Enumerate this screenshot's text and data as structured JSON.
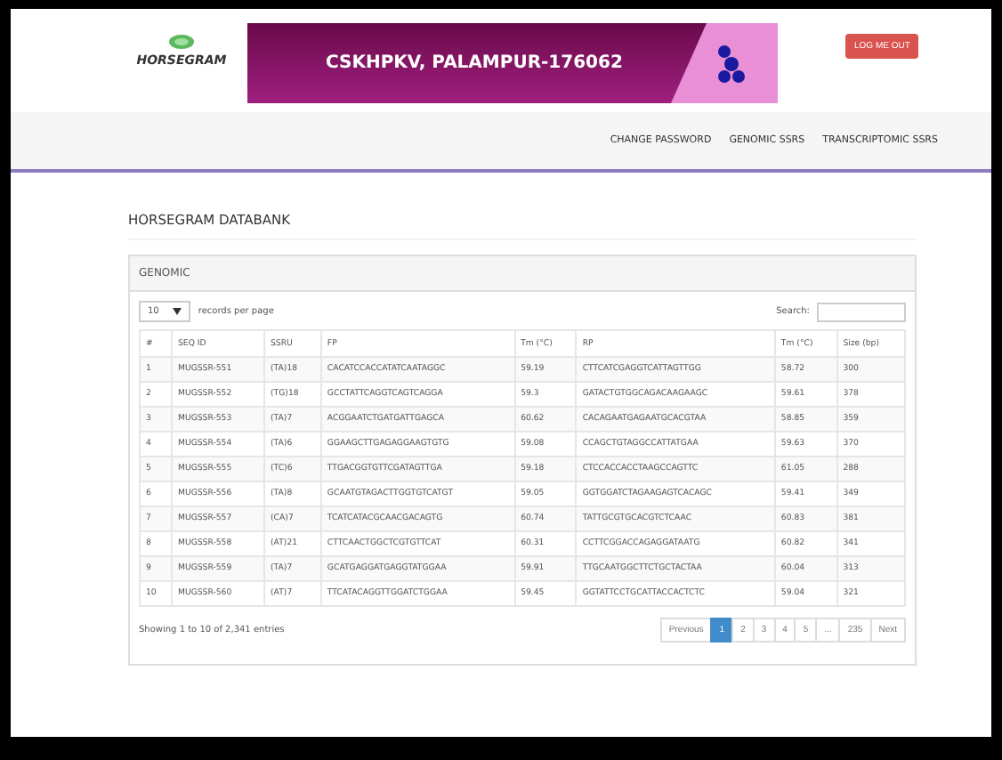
{
  "header": {
    "logo_text": "HORSEGRAM",
    "banner_title": "CSKHPKV, PALAMPUR-176062",
    "logout_button": "LOG ME OUT"
  },
  "nav": [
    {
      "label": "CHANGE PASSWORD"
    },
    {
      "label": "GENOMIC SSRS"
    },
    {
      "label": "TRANSCRIPTOMIC SSRS"
    }
  ],
  "page_title": "HORSEGRAM DATABANK",
  "panel": {
    "title": "GENOMIC",
    "page_size": "10",
    "page_size_label": "records per page",
    "search_label": "Search:",
    "columns": [
      "#",
      "SEQ ID",
      "SSRU",
      "FP",
      "Tm (°C)",
      "RP",
      "Tm (°C)",
      "Size (bp)"
    ],
    "rows": [
      [
        "1",
        "MUGSSR-551",
        "(TA)18",
        "CACATCCACCATATCAATAGGC",
        "59.19",
        "CTTCATCGAGGTCATTAGTTGG",
        "58.72",
        "300"
      ],
      [
        "2",
        "MUGSSR-552",
        "(TG)18",
        "GCCTATTCAGGTCAGTCAGGA",
        "59.3",
        "GATACTGTGGCAGACAAGAAGC",
        "59.61",
        "378"
      ],
      [
        "3",
        "MUGSSR-553",
        "(TA)7",
        "ACGGAATCTGATGATTGAGCA",
        "60.62",
        "CACAGAATGAGAATGCACGTAA",
        "58.85",
        "359"
      ],
      [
        "4",
        "MUGSSR-554",
        "(TA)6",
        "GGAAGCTTGAGAGGAAGTGTG",
        "59.08",
        "CCAGCTGTAGGCCATTATGAA",
        "59.63",
        "370"
      ],
      [
        "5",
        "MUGSSR-555",
        "(TC)6",
        "TTGACGGTGTTCGATAGTTGA",
        "59.18",
        "CTCCACCACCTAAGCCAGTTC",
        "61.05",
        "288"
      ],
      [
        "6",
        "MUGSSR-556",
        "(TA)8",
        "GCAATGTAGACTTGGTGTCATGT",
        "59.05",
        "GGTGGATCTAGAAGAGTCACAGC",
        "59.41",
        "349"
      ],
      [
        "7",
        "MUGSSR-557",
        "(CA)7",
        "TCATCATACGCAACGACAGTG",
        "60.74",
        "TATTGCGTGCACGTCTCAAC",
        "60.83",
        "381"
      ],
      [
        "8",
        "MUGSSR-558",
        "(AT)21",
        "CTTCAACTGGCTCGTGTTCAT",
        "60.31",
        "CCTTCGGACCAGAGGATAATG",
        "60.82",
        "341"
      ],
      [
        "9",
        "MUGSSR-559",
        "(TA)7",
        "GCATGAGGATGAGGTATGGAA",
        "59.91",
        "TTGCAATGGCTTCTGCTACTAA",
        "60.04",
        "313"
      ],
      [
        "10",
        "MUGSSR-560",
        "(AT)7",
        "TTCATACAGGTTGGATCTGGAA",
        "59.45",
        "GGTATTCCTGCATTACCACTCTC",
        "59.04",
        "321"
      ]
    ],
    "info": "Showing 1 to 10 of 2,341 entries",
    "pagination": [
      {
        "label": "Previous",
        "selected": false
      },
      {
        "label": "1",
        "selected": true
      },
      {
        "label": "2",
        "selected": false
      },
      {
        "label": "3",
        "selected": false
      },
      {
        "label": "4",
        "selected": false
      },
      {
        "label": "5",
        "selected": false
      },
      {
        "label": "...",
        "selected": false
      },
      {
        "label": "235",
        "selected": false
      },
      {
        "label": "Next",
        "selected": false
      }
    ]
  }
}
